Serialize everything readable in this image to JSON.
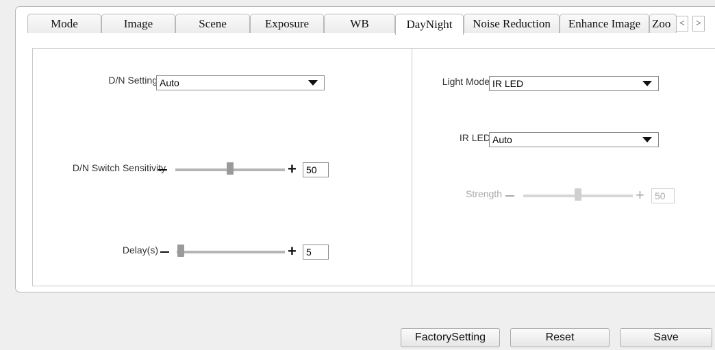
{
  "tabs": [
    "Mode",
    "Image",
    "Scene",
    "Exposure",
    "WB",
    "DayNight",
    "Noise Reduction",
    "Enhance Image",
    "Zoo"
  ],
  "active_tab": "DayNight",
  "nav": {
    "prev": "<",
    "next": ">"
  },
  "left": {
    "dn_setting": {
      "label": "D/N Setting",
      "value": "Auto"
    },
    "sensitivity": {
      "label": "D/N Switch Sensitivity",
      "value": "50",
      "level_percent": 50
    },
    "delay": {
      "label": "Delay(s)",
      "value": "5",
      "level_percent": 5
    }
  },
  "right": {
    "light_mode": {
      "label": "Light Mode",
      "value": "IR LED"
    },
    "ir_led": {
      "label": "IR LED",
      "value": "Auto"
    },
    "strength": {
      "label": "Strength",
      "value": "50",
      "level_percent": 50,
      "disabled": true
    }
  },
  "buttons": {
    "factory": "FactorySetting",
    "reset": "Reset",
    "save": "Save"
  },
  "icons": {
    "dropdown": "caret-down-icon",
    "decrease": "minus-icon",
    "increase": "plus-icon"
  }
}
